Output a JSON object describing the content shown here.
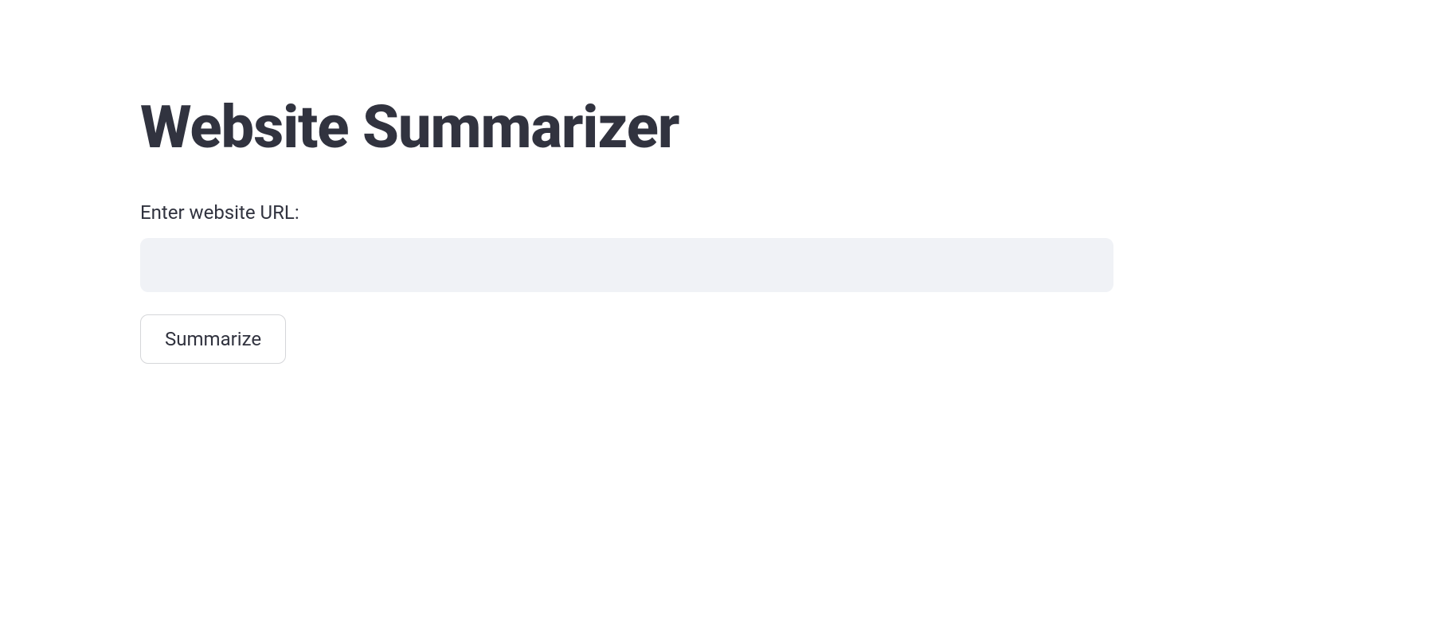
{
  "header": {
    "title": "Website Summarizer"
  },
  "form": {
    "url_label": "Enter website URL:",
    "url_value": "",
    "submit_label": "Summarize"
  }
}
